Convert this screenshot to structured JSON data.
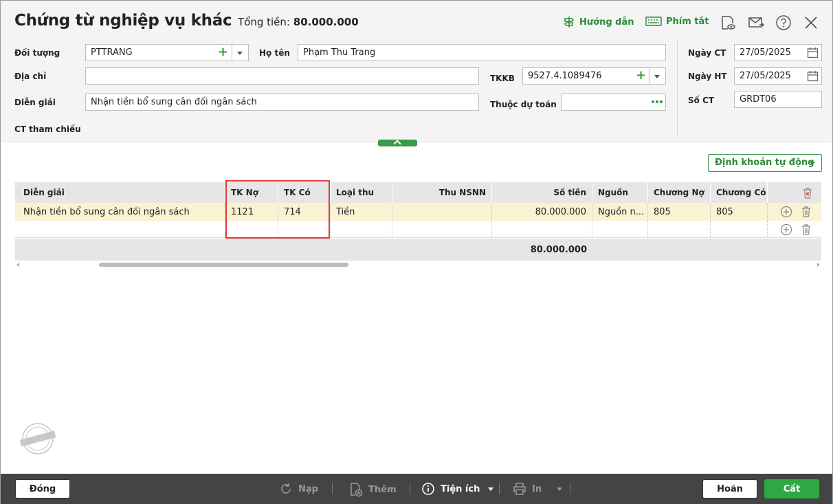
{
  "header": {
    "title": "Chứng từ nghiệp vụ khác",
    "total_label": "Tổng tiền:",
    "total_value": "80.000.000",
    "guide_label": "Hướng dẫn",
    "shortcut_label": "Phím tắt"
  },
  "form": {
    "doi_tuong_label": "Đối tượng",
    "doi_tuong_value": "PTTRANG",
    "ho_ten_label": "Họ tên",
    "ho_ten_value": "Phạm Thu Trang",
    "dia_chi_label": "Địa chỉ",
    "dia_chi_value": "",
    "tkkb_label": "TKKB",
    "tkkb_value": "9527.4.1089476",
    "dien_giai_label": "Diễn giải",
    "dien_giai_value": "Nhận tiền bổ sung cân đối ngân sách",
    "thuoc_du_toan_label": "Thuộc dự toán",
    "thuoc_du_toan_value": "",
    "ct_tham_chieu_label": "CT tham chiếu",
    "ngay_ct_label": "Ngày CT",
    "ngay_ct_value": "27/05/2025",
    "ngay_ht_label": "Ngày HT",
    "ngay_ht_value": "27/05/2025",
    "so_ct_label": "Số CT",
    "so_ct_value": "GRDT06"
  },
  "auto_account_button": "Định khoản tự động",
  "grid": {
    "columns": [
      "Diễn giải",
      "TK Nợ",
      "TK Có",
      "Loại thu",
      "Thu NSNN",
      "Số tiền",
      "Nguồn",
      "Chương Nợ",
      "Chương Có"
    ],
    "rows": [
      {
        "dien_giai": "Nhận tiền bổ sung cân đối ngân sách",
        "tk_no": "1121",
        "tk_co": "714",
        "loai_thu": "Tiền",
        "thu_nsnn": "",
        "so_tien": "80.000.000",
        "nguon": "Nguồn n...",
        "chuong_no": "805",
        "chuong_co": "805"
      }
    ],
    "total_so_tien": "80.000.000"
  },
  "footer": {
    "close": "Đóng",
    "reload": "Nạp",
    "add": "Thêm",
    "utility": "Tiện ích",
    "print": "In",
    "undo": "Hoãn",
    "save": "Cất"
  },
  "colors": {
    "accent": "#2fa844",
    "highlight_row": "#fbf1d3",
    "highlight_box": "#e23b3b",
    "footer_bg": "#444444"
  }
}
